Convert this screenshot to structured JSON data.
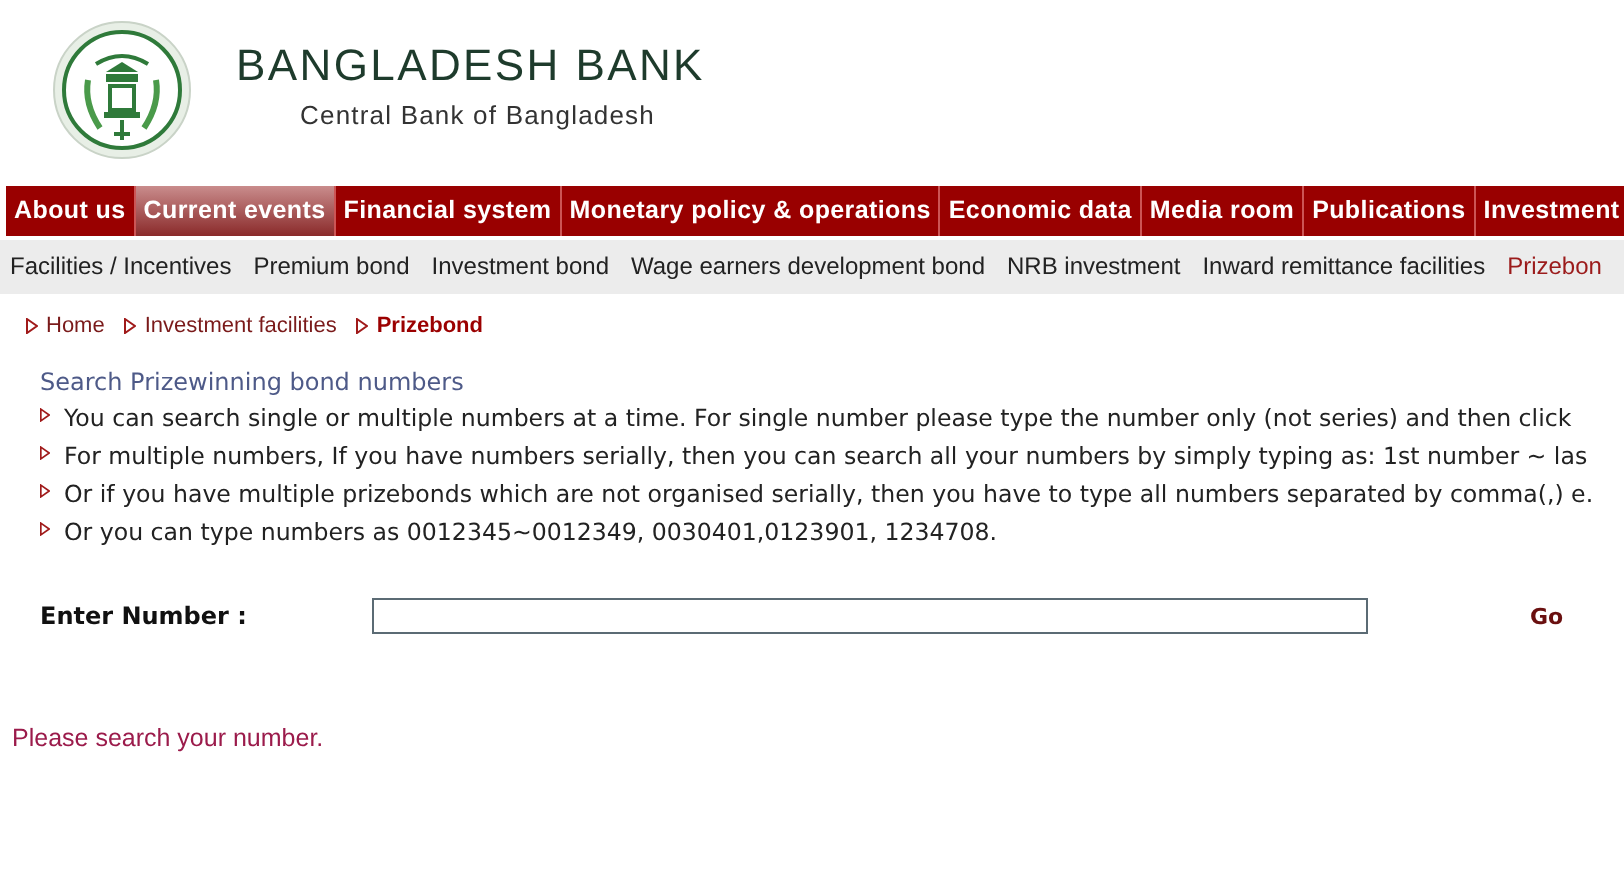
{
  "header": {
    "title": "BANGLADESH BANK",
    "subtitle": "Central Bank of Bangladesh"
  },
  "main_nav": [
    {
      "label": "About us",
      "selected": false
    },
    {
      "label": "Current events",
      "selected": true
    },
    {
      "label": "Financial system",
      "selected": false
    },
    {
      "label": "Monetary policy & operations",
      "selected": false
    },
    {
      "label": "Economic data",
      "selected": false
    },
    {
      "label": "Media room",
      "selected": false
    },
    {
      "label": "Publications",
      "selected": false
    },
    {
      "label": "Investment",
      "selected": false
    }
  ],
  "sub_nav": [
    {
      "label": "Facilities / Incentives",
      "selected": false
    },
    {
      "label": "Premium bond",
      "selected": false
    },
    {
      "label": "Investment bond",
      "selected": false
    },
    {
      "label": "Wage earners development bond",
      "selected": false
    },
    {
      "label": "NRB investment",
      "selected": false
    },
    {
      "label": "Inward remittance facilities",
      "selected": false
    },
    {
      "label": "Prizebon",
      "selected": true
    }
  ],
  "breadcrumb": [
    {
      "label": "Home",
      "current": false
    },
    {
      "label": "Investment facilities",
      "current": false
    },
    {
      "label": "Prizebond",
      "current": true
    }
  ],
  "section_title": "Search Prizewinning bond numbers",
  "instructions": [
    "You can search single or multiple numbers at a time. For single number please type the number only (not series) and then click",
    "For multiple numbers, If you have numbers serially, then you can search all your numbers by simply typing as: 1st number ~ las",
    "Or if you have multiple prizebonds which are not organised serially, then you have to type all numbers separated by comma(,) e.",
    "Or you can type numbers as 0012345~0012349, 0030401,0123901, 1234708."
  ],
  "form": {
    "label": "Enter Number :",
    "button": "Go"
  },
  "message": "Please search your number."
}
